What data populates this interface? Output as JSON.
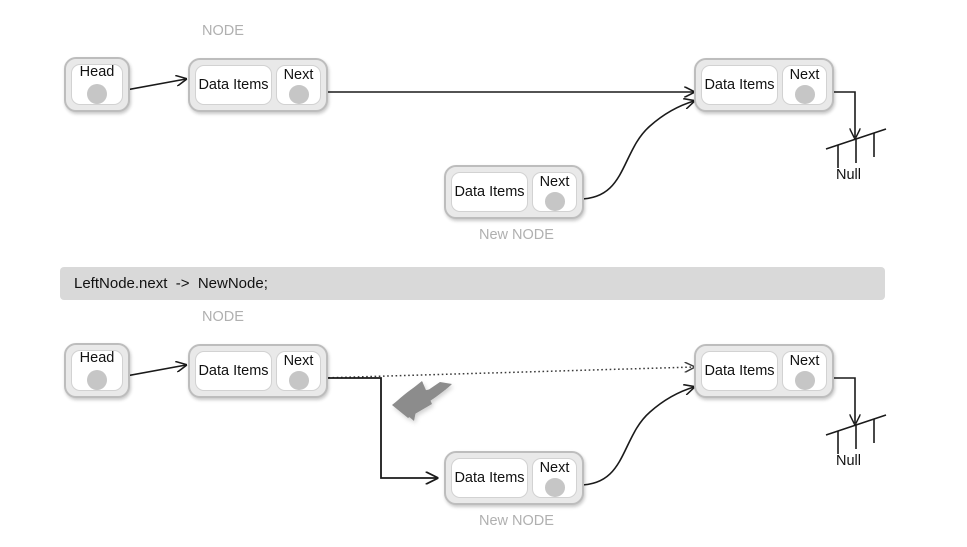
{
  "diagram": {
    "title_hidden": "",
    "colors": {
      "node_fill": "#e9e9e9",
      "node_border": "#bdbdbd",
      "cell_fill": "#ffffff",
      "dot": "#c6c6c6",
      "caption": "#b0b0b0",
      "line": "#1a1a1a",
      "gray_arrow": "#8c8c8c",
      "banner_bg": "#d9d9d9",
      "text": "#111111"
    }
  },
  "code_banner": {
    "text": "LeftNode.next  ->  NewNode;"
  },
  "top_panel": {
    "name": "before-insert",
    "caption_node": "NODE",
    "caption_new_node": "New NODE",
    "head": {
      "label": "Head"
    },
    "left_node": {
      "data_label": "Data Items",
      "next_label": "Next"
    },
    "right_node": {
      "data_label": "Data Items",
      "next_label": "Next"
    },
    "new_node": {
      "data_label": "Data Items",
      "next_label": "Next"
    },
    "null_label": "Null"
  },
  "bottom_panel": {
    "name": "after-insert",
    "caption_node": "NODE",
    "caption_new_node": "New NODE",
    "head": {
      "label": "Head"
    },
    "left_node": {
      "data_label": "Data Items",
      "next_label": "Next"
    },
    "right_node": {
      "data_label": "Data Items",
      "next_label": "Next"
    },
    "new_node": {
      "data_label": "Data Items",
      "next_label": "Next"
    },
    "null_label": "Null"
  }
}
